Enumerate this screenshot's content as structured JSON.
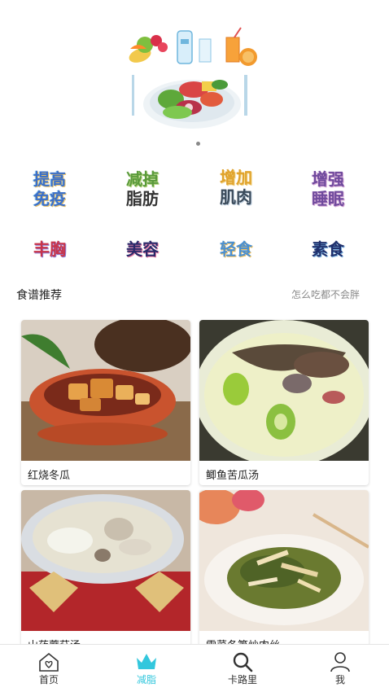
{
  "categories": [
    {
      "line1": "提高",
      "line2": "免疫"
    },
    {
      "line1": "减掉",
      "line2": "脂肪"
    },
    {
      "line1": "增加",
      "line2": "肌肉"
    },
    {
      "line1": "增强",
      "line2": "睡眠"
    },
    {
      "line1": "丰胸",
      "line2": ""
    },
    {
      "line1": "美容",
      "line2": ""
    },
    {
      "line1": "轻食",
      "line2": ""
    },
    {
      "line1": "素食",
      "line2": ""
    }
  ],
  "recipes": {
    "title": "食谱推荐",
    "subtitle": "怎么吃都不会胖",
    "items": [
      {
        "name": "红烧冬瓜"
      },
      {
        "name": "鲫鱼苦瓜汤"
      },
      {
        "name": "山药蘑菇汤"
      },
      {
        "name": "雪菜冬笋炒肉丝"
      }
    ]
  },
  "tabbar": {
    "items": [
      {
        "label": "首页",
        "icon": "home-icon"
      },
      {
        "label": "减脂",
        "icon": "crown-icon"
      },
      {
        "label": "卡路里",
        "icon": "search-icon"
      },
      {
        "label": "我",
        "icon": "user-icon"
      }
    ],
    "active_color": "#33c7dd"
  }
}
